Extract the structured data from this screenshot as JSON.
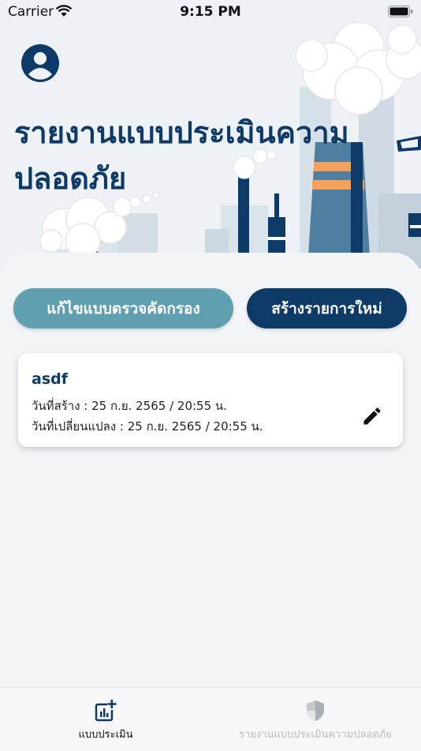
{
  "status": {
    "carrier": "Carrier",
    "time": "9:15 PM"
  },
  "header": {
    "title": "รายงานแบบประเมินความปลอดภัย"
  },
  "actions": {
    "edit_screening": "แก้ไขแบบตรวจคัดกรอง",
    "create_new": "สร้างรายการใหม่"
  },
  "records": [
    {
      "name": "asdf",
      "created": "วันที่สร้าง : 25 ก.ย. 2565 / 20:55 น.",
      "modified": "วันที่เปลี่ยนแปลง : 25 ก.ย. 2565 / 20:55 น."
    }
  ],
  "tabs": [
    {
      "label": "แบบประเมิน",
      "icon": "chart-add-icon",
      "active": true
    },
    {
      "label": "รายงานแบบประเมินความปลอดภัย",
      "icon": "shield-icon",
      "active": false
    }
  ],
  "colors": {
    "primary": "#0d3a66",
    "secondary": "#5f9fb0",
    "background": "#f2f4f8",
    "inactive": "#b8bcc4"
  }
}
